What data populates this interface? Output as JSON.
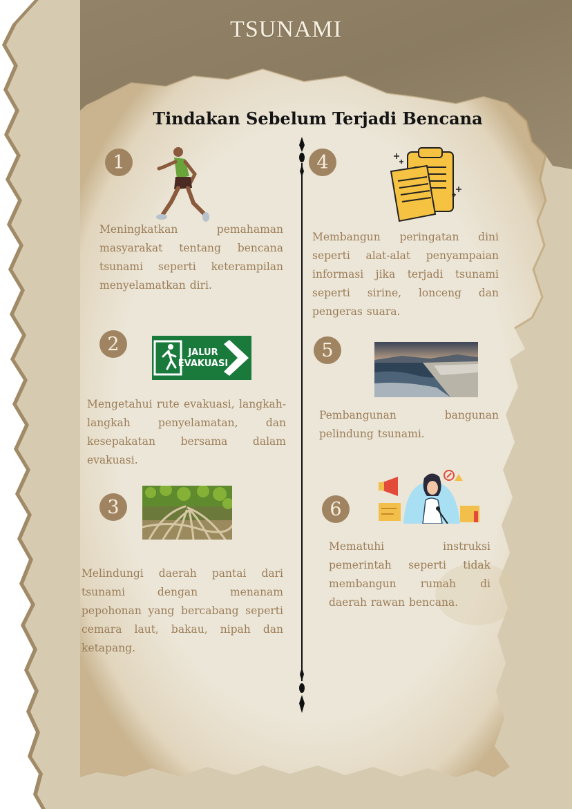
{
  "header": {
    "title": "TSUNAMI",
    "subtitle": "Tindakan Sebelum Terjadi Bencana"
  },
  "colors": {
    "kraft": "#8f8066",
    "parchment": "#ede7da",
    "border": "#d8cdb2",
    "badge": "#a08461",
    "body_text": "#9b7d58",
    "sign_green": "#1a7a3c"
  },
  "steps": [
    {
      "number": "1",
      "icon": "running-person-icon",
      "text": "Meningkatkan pemahaman masyarakat tentang bencana tsunami seperti keterampilan menyelamatkan diri."
    },
    {
      "number": "2",
      "icon": "evacuation-sign-icon",
      "sign_text_1": "JALUR",
      "sign_text_2": "EVAKUASI",
      "text": "Mengetahui rute evakuasi, langkah-langkah penyelamatan, dan kesepakatan bersama dalam evakuasi."
    },
    {
      "number": "3",
      "icon": "mangrove-roots-photo",
      "text": "Melindungi daerah pantai dari tsunami dengan menanam pepohonan yang bercabang seperti cemara laut, bakau, nipah dan ketapang."
    },
    {
      "number": "4",
      "icon": "clipboard-document-icon",
      "text": "Membangun peringatan dini seperti alat-alat penyampaian informasi jika terjadi tsunami seperti sirine, lonceng dan pengeras suara."
    },
    {
      "number": "5",
      "icon": "seawall-photo",
      "text": "Pembangunan bangunan pelindung tsunami."
    },
    {
      "number": "6",
      "icon": "announcer-woman-icon",
      "text": "Mematuhi instruksi pemerintah seperti tidak membangun rumah di daerah rawan bencana."
    }
  ]
}
